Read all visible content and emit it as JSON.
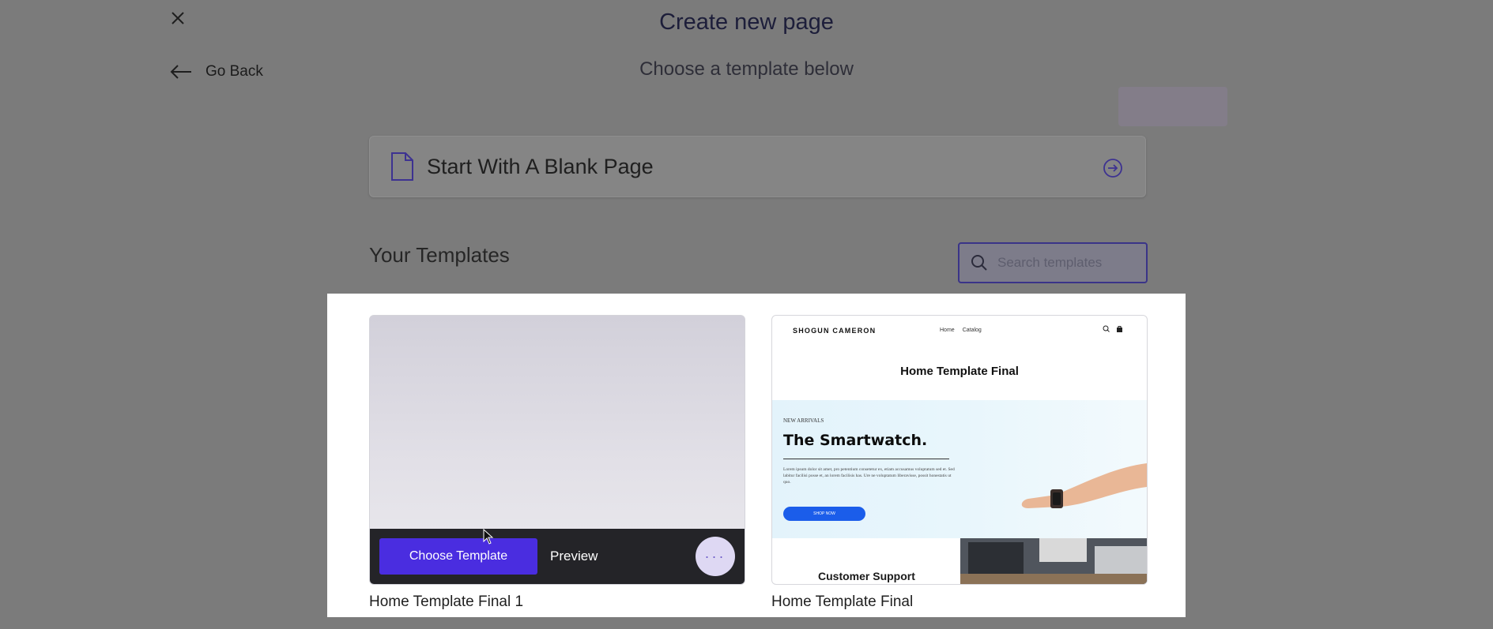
{
  "header": {
    "title": "Create new page",
    "subtitle": "Choose a template below",
    "go_back_label": "Go Back"
  },
  "blank_page": {
    "label": "Start With A Blank Page"
  },
  "templates_section": {
    "heading": "Your Templates",
    "search_placeholder": "Search templates"
  },
  "templates": [
    {
      "name": "Home Template Final 1",
      "choose_label": "Choose Template",
      "preview_label": "Preview",
      "more_label": "···"
    },
    {
      "name": "Home Template Final",
      "preview": {
        "brand": "SHOGUN CAMERON",
        "nav_links": [
          "Home",
          "Catalog"
        ],
        "heading": "Home Template Final",
        "kicker": "NEW ARRIVALS",
        "product_title": "The Smartwatch.",
        "body_copy": "Lorem ipsum dolor sit amet, pro petentium consetetur ex, etiam accusamus voluptatum sed et. Sed labitur facilisi posse et, an lorem facilisis has. Ure ne voluptatum liberavisse, possit honestatis ut quo.",
        "cta_label": "SHOP NOW",
        "support_label": "Customer Support"
      }
    }
  ],
  "colors": {
    "accent": "#4a2de0",
    "overlay": "#7b7b7b",
    "cta_blue": "#1b5dea"
  },
  "icons": [
    "close-icon",
    "arrow-left-icon",
    "document-icon",
    "arrow-right-circle-icon",
    "search-icon",
    "cursor-icon"
  ]
}
